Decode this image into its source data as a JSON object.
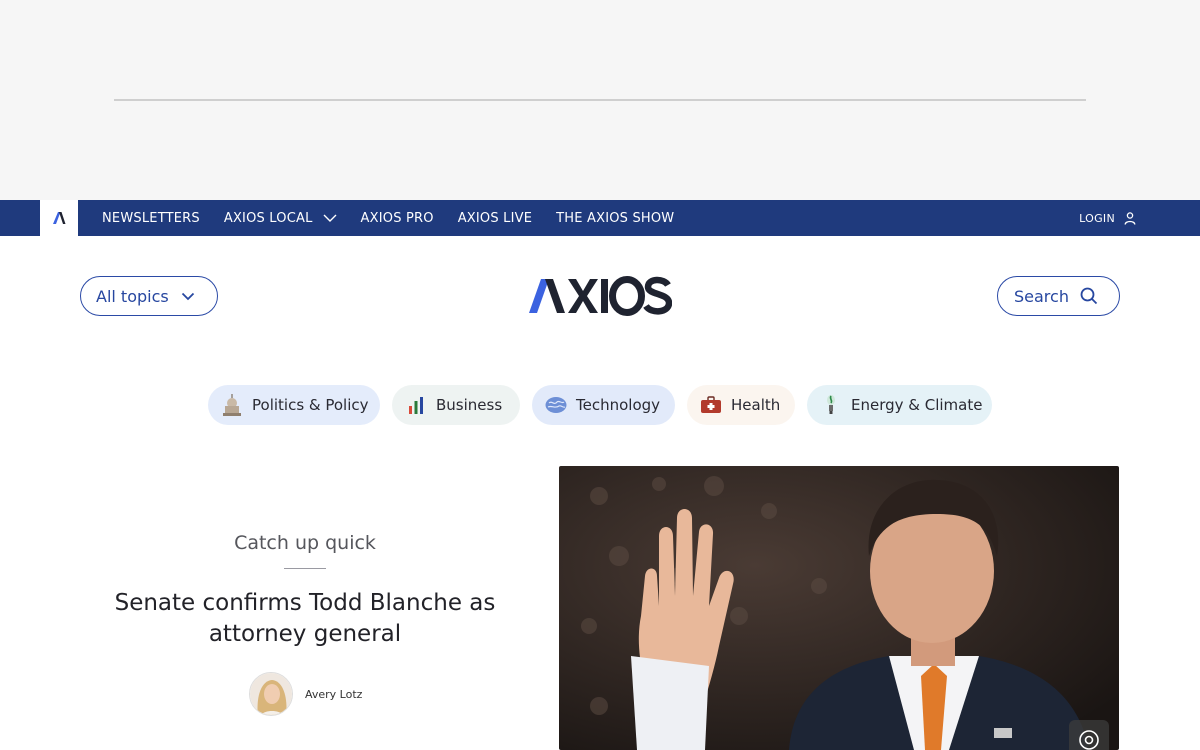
{
  "topbar": {
    "nav": [
      {
        "label": "NEWSLETTERS"
      },
      {
        "label": "AXIOS LOCAL"
      },
      {
        "label": "AXIOS PRO"
      },
      {
        "label": "AXIOS LIVE"
      },
      {
        "label": "THE AXIOS SHOW"
      }
    ],
    "login_label": "LOGIN"
  },
  "masthead": {
    "all_topics_label": "All topics",
    "brand": "AXIOS",
    "search_label": "Search"
  },
  "topics": [
    {
      "label": "Politics & Policy",
      "icon": "capitol-icon"
    },
    {
      "label": "Business",
      "icon": "bar-chart-icon"
    },
    {
      "label": "Technology",
      "icon": "brain-chip-icon"
    },
    {
      "label": "Health",
      "icon": "first-aid-kit-icon"
    },
    {
      "label": "Energy & Climate",
      "icon": "lightbulb-plant-icon"
    }
  ],
  "story": {
    "kicker": "Catch up quick",
    "headline": "Senate confirms Todd Blanche as attorney general",
    "author": "Avery Lotz"
  },
  "colors": {
    "nav_bar": "#1f3a7d",
    "accent": "#2747a0",
    "brand_blue": "#3b62e0",
    "brand_dark": "#1f2330"
  }
}
